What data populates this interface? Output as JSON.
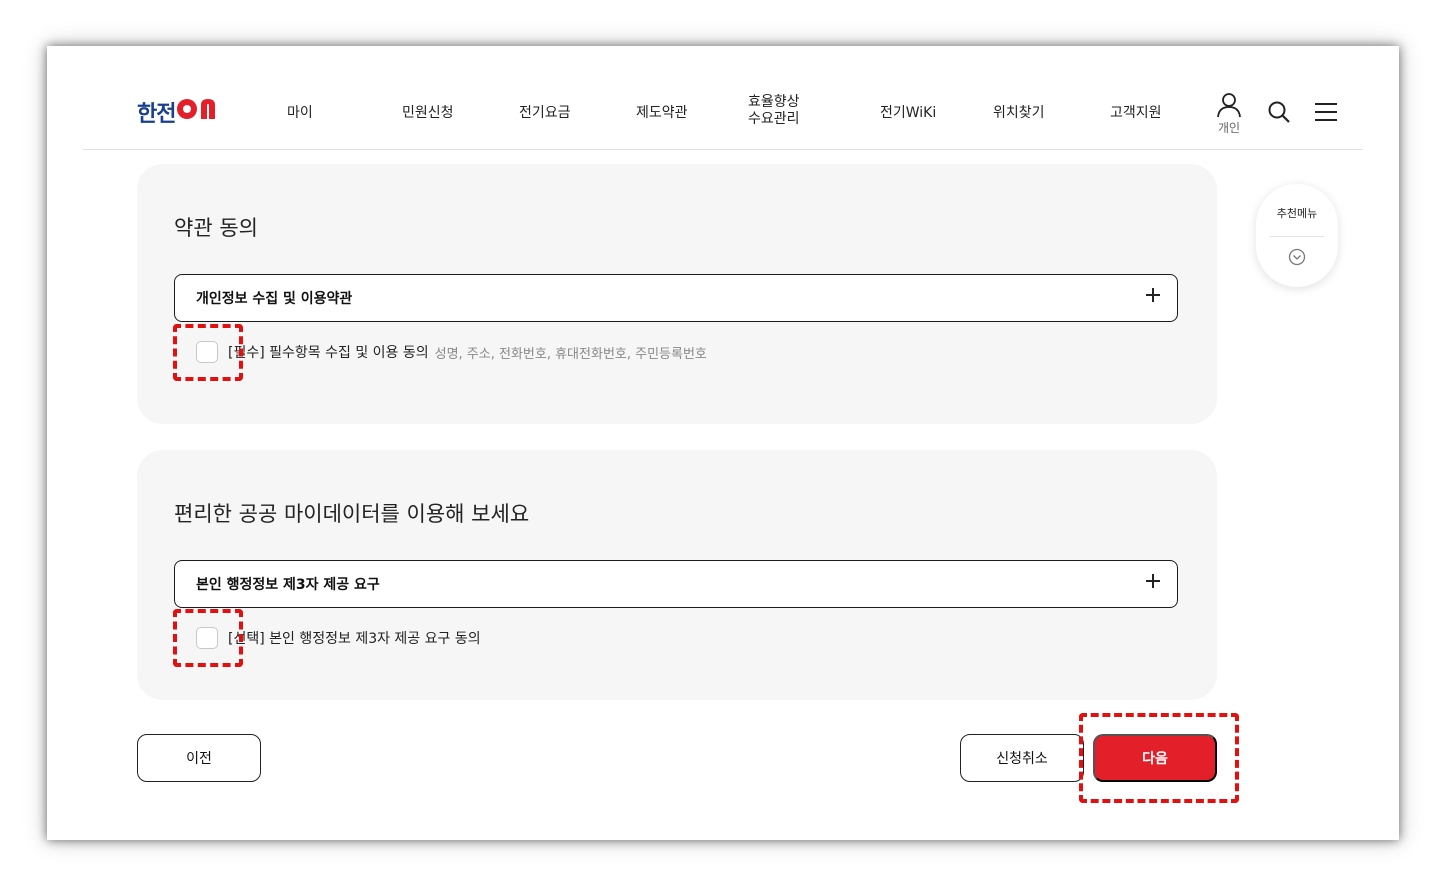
{
  "header": {
    "logo_part1": "한전",
    "logo_part2": "ON",
    "nav": [
      "마이",
      "민원신청",
      "전기요금",
      "제도약관",
      "효율향상\n수요관리",
      "전기WiKi",
      "위치찾기",
      "고객지원"
    ],
    "nav_two_line": {
      "line1": "효율향상",
      "line2": "수요관리"
    },
    "user_label": "개인"
  },
  "recommend": {
    "label": "추천메뉴"
  },
  "section1": {
    "title": "약관 동의",
    "accordion_label": "개인정보 수집 및 이용약관",
    "checkbox_label": "[필수] 필수항목 수집 및 이용 동의",
    "checkbox_sub": "성명, 주소, 전화번호, 휴대전화번호, 주민등록번호",
    "checked": false
  },
  "section2": {
    "title": "편리한 공공 마이데이터를 이용해 보세요",
    "accordion_label": "본인 행정정보 제3자 제공 요구",
    "checkbox_label": "[선택] 본인 행정정보 제3자 제공 요구 동의",
    "checked": false
  },
  "buttons": {
    "prev": "이전",
    "cancel": "신청취소",
    "next": "다음"
  },
  "colors": {
    "brand_blue": "#1a3f8f",
    "brand_red": "#e3202a",
    "annotation": "#e31010"
  }
}
